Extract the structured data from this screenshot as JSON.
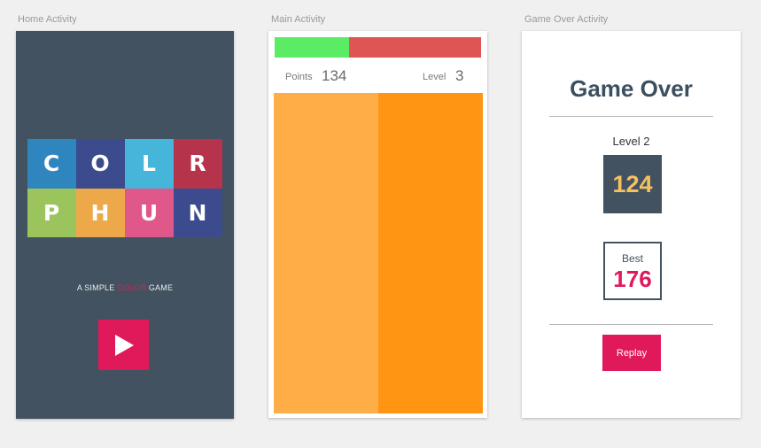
{
  "captions": {
    "home": "Home Activity",
    "main": "Main Activity",
    "over": "Game Over Activity"
  },
  "home": {
    "logo": [
      {
        "letter": "C",
        "color": "#2f85be"
      },
      {
        "letter": "O",
        "color": "#3b4b8d"
      },
      {
        "letter": "L",
        "color": "#45b5d9"
      },
      {
        "letter": "R",
        "color": "#b5344c"
      },
      {
        "letter": "P",
        "color": "#9cc45c"
      },
      {
        "letter": "H",
        "color": "#eda84a"
      },
      {
        "letter": "U",
        "color": "#df5889"
      },
      {
        "letter": "N",
        "color": "#3b4b8d"
      }
    ],
    "tagline_before": "A SIMPLE ",
    "tagline_highlight": "COLOR",
    "tagline_after": " GAME",
    "play_icon": "play-icon"
  },
  "main": {
    "timer": {
      "remaining_fraction": 0.36,
      "fill_color": "#5bec66",
      "empty_color": "#df5553"
    },
    "points_label": "Points",
    "points_value": "134",
    "level_label": "Level",
    "level_value": "3",
    "panels": [
      {
        "color": "#ffad47"
      },
      {
        "color": "#ff9512"
      }
    ]
  },
  "over": {
    "title": "Game Over",
    "level_text": "Level 2",
    "score": "124",
    "best_label": "Best",
    "best_value": "176",
    "replay_label": "Replay"
  }
}
